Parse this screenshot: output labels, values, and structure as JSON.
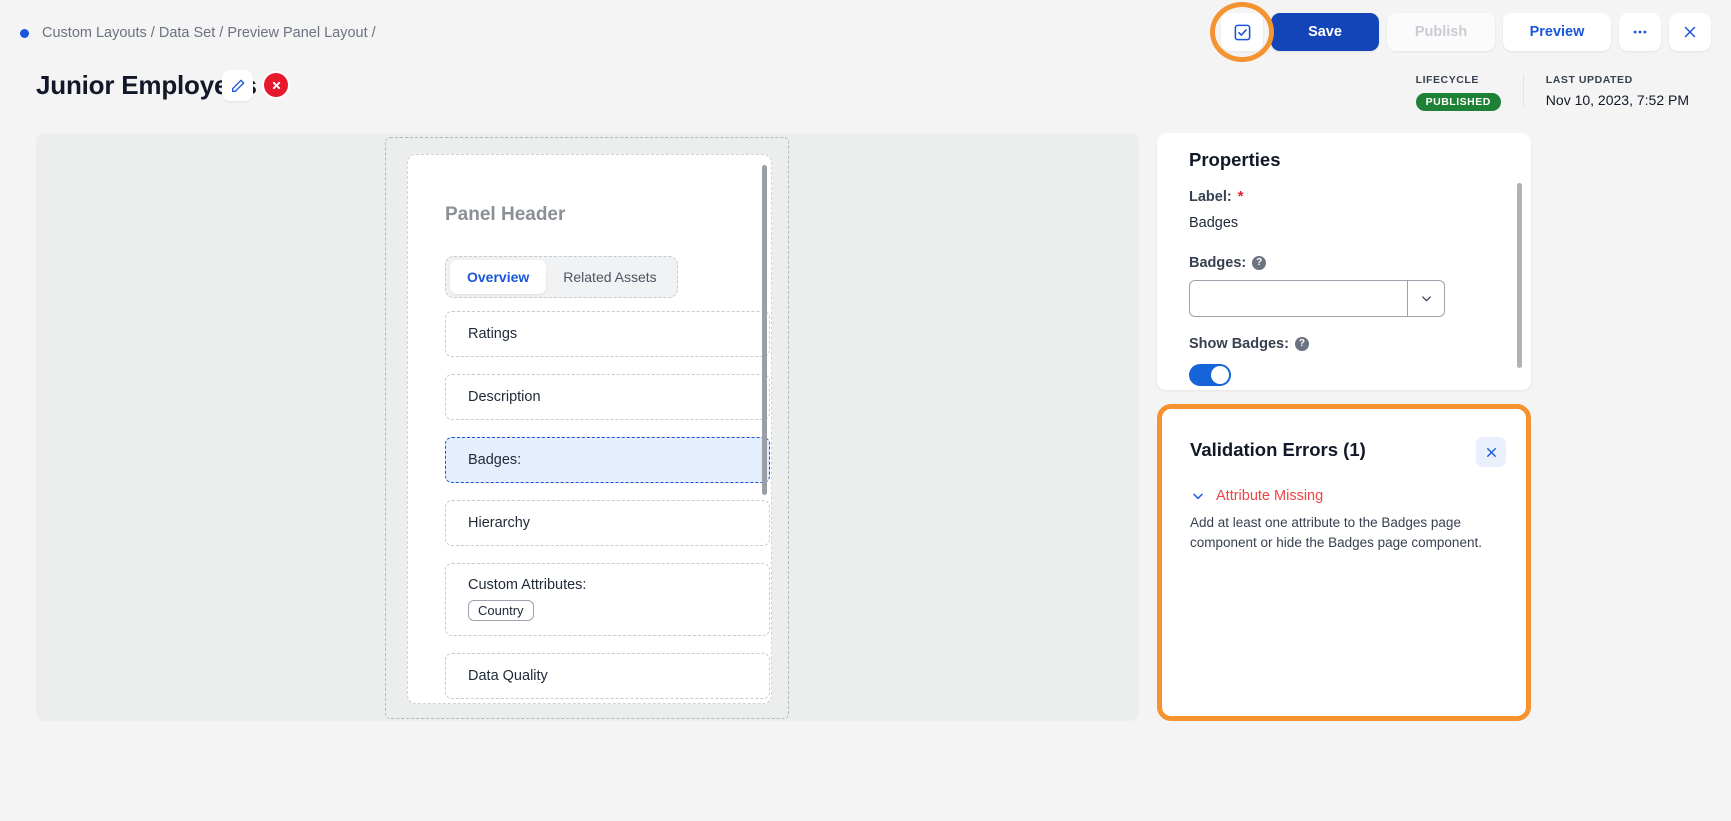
{
  "breadcrumb": {
    "path": "Custom Layouts / Data Set / Preview Panel Layout /"
  },
  "header": {
    "title": "Junior Employees",
    "edit_icon": "pencil-icon",
    "error_badge": "×",
    "validate_icon": "checkbox-check-icon",
    "save_label": "Save",
    "publish_label": "Publish",
    "preview_label": "Preview",
    "more_icon": "ellipsis-icon",
    "close_icon": "close-icon"
  },
  "meta": {
    "lifecycle_label": "LIFECYCLE",
    "lifecycle_value": "PUBLISHED",
    "last_updated_label": "LAST UPDATED",
    "last_updated_value": "Nov 10, 2023, 7:52 PM"
  },
  "canvas": {
    "panel_header": "Panel Header",
    "tabs": [
      {
        "label": "Overview",
        "active": true
      },
      {
        "label": "Related Assets",
        "active": false
      }
    ],
    "components": [
      {
        "label": "Ratings",
        "selected": false
      },
      {
        "label": "Description",
        "selected": false
      },
      {
        "label": "Badges:",
        "selected": true
      },
      {
        "label": "Hierarchy",
        "selected": false
      },
      {
        "label": "Custom Attributes:",
        "selected": false,
        "chips": [
          "Country"
        ]
      },
      {
        "label": "Data Quality",
        "selected": false
      }
    ]
  },
  "properties": {
    "title": "Properties",
    "label_field_label": "Label:",
    "label_required_marker": "*",
    "label_value": "Badges",
    "badges_field_label": "Badges:",
    "badges_help_icon": "help-circle-icon",
    "badges_value": "",
    "badges_placeholder": "",
    "badges_dropdown_icon": "chevron-down-icon",
    "show_badges_label": "Show Badges:",
    "show_badges_help_icon": "help-circle-icon",
    "show_badges_on": true
  },
  "validation": {
    "title": "Validation Errors (1)",
    "close_icon": "close-icon",
    "items": [
      {
        "expand_icon": "chevron-down-icon",
        "label": "Attribute Missing",
        "description": "Add at least one attribute to the Badges page component or hide the Badges page component."
      }
    ]
  },
  "colors": {
    "accent_blue": "#1344b8",
    "link_blue": "#1a56db",
    "highlight_orange": "#f59331",
    "error_red": "#e8192c",
    "published_green": "#1e8136"
  }
}
